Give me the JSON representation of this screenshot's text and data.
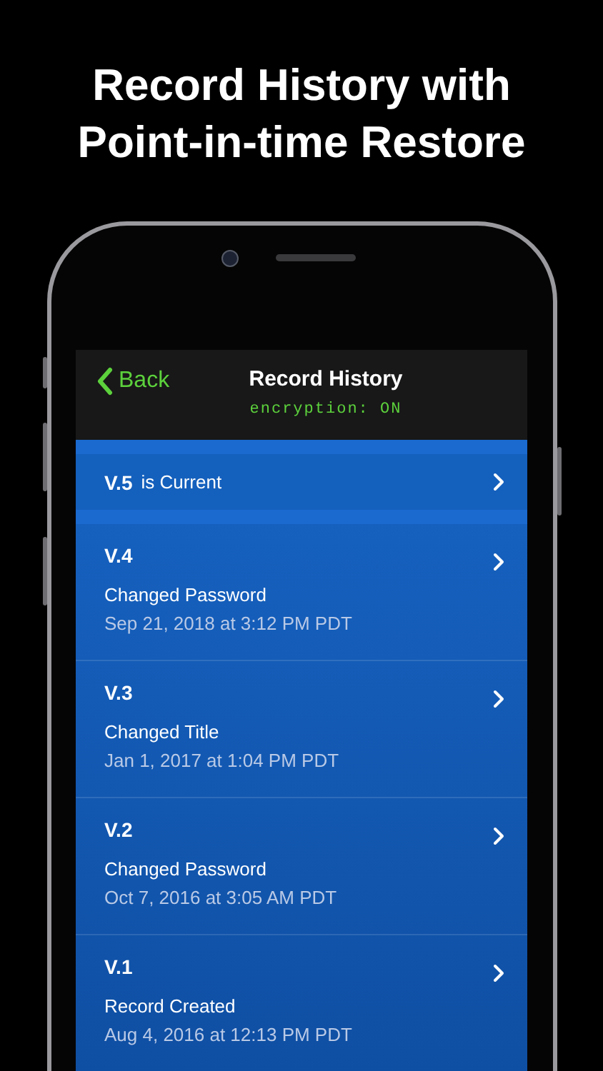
{
  "headline": "Record History with Point-in-time Restore",
  "nav": {
    "back": "Back",
    "title": "Record History",
    "subtitle": "encryption: ON"
  },
  "current": {
    "version": "V.5",
    "label": "is Current"
  },
  "versions": [
    {
      "version": "V.4",
      "change": "Changed Password",
      "date": "Sep 21, 2018 at 3:12 PM PDT"
    },
    {
      "version": "V.3",
      "change": "Changed Title",
      "date": "Jan 1, 2017 at 1:04 PM PDT"
    },
    {
      "version": "V.2",
      "change": "Changed Password",
      "date": "Oct 7, 2016 at 3:05 AM PDT"
    },
    {
      "version": "V.1",
      "change": "Record Created",
      "date": "Aug 4, 2016 at 12:13 PM PDT"
    }
  ]
}
